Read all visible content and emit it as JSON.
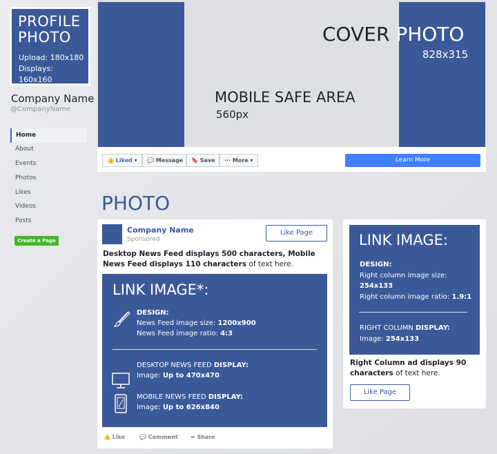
{
  "profile": {
    "title_line1": "PROFILE",
    "title_line2": "PHOTO",
    "upload": "Upload: 180x180",
    "displays": "Displays: 160x160"
  },
  "page": {
    "company_name": "Company Name",
    "handle": "@CompanyName"
  },
  "sidebar": {
    "items": [
      {
        "label": "Home",
        "active": true
      },
      {
        "label": "About"
      },
      {
        "label": "Events"
      },
      {
        "label": "Photos"
      },
      {
        "label": "Likes"
      },
      {
        "label": "Videos"
      },
      {
        "label": "Posts"
      }
    ],
    "create_page": "Create a Page"
  },
  "cover": {
    "title_part1": "COVER ",
    "title_part2": "PHOTO",
    "size": "828x315",
    "safe_area_label": "MOBILE SAFE AREA",
    "safe_area_size": "560px"
  },
  "action_bar": {
    "liked": "Liked",
    "message": "Message",
    "save": "Save",
    "more": "··· More",
    "learn_more": "Learn More"
  },
  "section_title": "PHOTO",
  "post": {
    "company": "Company Name",
    "sponsored": "Sponsored",
    "like_page": "Like Page",
    "text_bold": "Desktop News Feed displays 500 characters, Mobile News Feed displays 110 characters",
    "text_rest": " of text here.",
    "link_title": "LINK IMAGE*:",
    "design_label": "DESIGN:",
    "size_label": "News Feed image size: ",
    "size_value": "1200x900",
    "ratio_label": "News Feed image ratio: ",
    "ratio_value": "4:3",
    "desktop_label": "DESKTOP NEWS FEED ",
    "desktop_bold": "DISPLAY:",
    "desktop_image_label": "Image: ",
    "desktop_image_value": "Up to 470x470",
    "mobile_label": "MOBILE NEWS FEED ",
    "mobile_bold": "DISPLAY:",
    "mobile_image_label": "Image: ",
    "mobile_image_value": "Up to 626x840",
    "footer_like": "Like",
    "footer_comment": "Comment",
    "footer_share": "Share"
  },
  "right_column": {
    "title": "LINK IMAGE:",
    "design_label": "DESIGN:",
    "size_label": "Right column image size:",
    "size_value": "254x133",
    "ratio_label": "Right column image ratio: ",
    "ratio_value": "1.9:1",
    "display_label": "RIGHT COLUMN ",
    "display_bold": "DISPLAY:",
    "image_label": "Image: ",
    "image_value": "254x133",
    "text_bold": "Right Column ad displays 90 characters",
    "text_rest": " of text here.",
    "like_page": "Like Page"
  },
  "colors": {
    "brand_blue": "#3b5998",
    "cta_blue": "#4080ff",
    "create_green": "#42b72a"
  }
}
